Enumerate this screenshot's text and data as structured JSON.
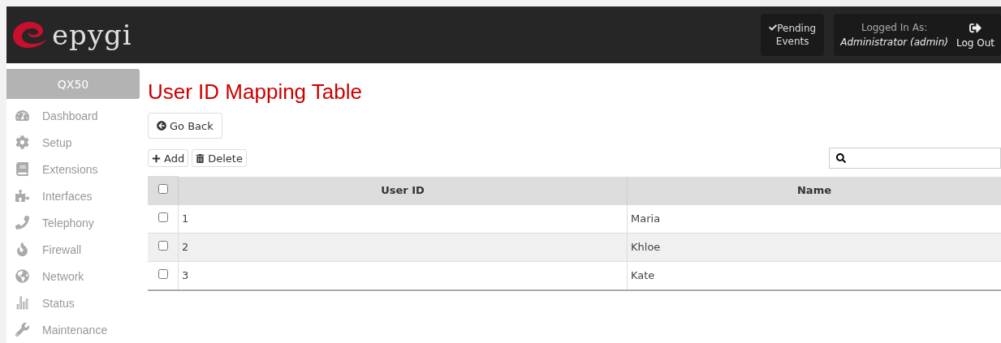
{
  "header": {
    "logo": "epygi",
    "pending_events": {
      "label": "Pending Events"
    },
    "user": {
      "caption": "Logged In As:",
      "name": "Administrator (admin)"
    },
    "logout": "Log Out"
  },
  "sidebar": {
    "device": "QX50",
    "items": [
      {
        "kind": "dashboard",
        "label": "Dashboard"
      },
      {
        "kind": "setup",
        "label": "Setup"
      },
      {
        "kind": "extensions",
        "label": "Extensions"
      },
      {
        "kind": "interfaces",
        "label": "Interfaces"
      },
      {
        "kind": "telephony",
        "label": "Telephony"
      },
      {
        "kind": "firewall",
        "label": "Firewall"
      },
      {
        "kind": "network",
        "label": "Network"
      },
      {
        "kind": "status",
        "label": "Status"
      },
      {
        "kind": "maintenance",
        "label": "Maintenance"
      }
    ]
  },
  "page": {
    "title": "User ID Mapping Table",
    "back_button": "Go Back",
    "toolbar": [
      "Add",
      "Delete"
    ]
  },
  "table": {
    "select_all": {
      "checked": false
    },
    "columns": [
      "User ID",
      "Name"
    ],
    "rows": [
      {
        "checked": false,
        "cells": [
          "1",
          "Maria"
        ]
      },
      {
        "checked": false,
        "cells": [
          "2",
          "Khloe"
        ]
      },
      {
        "checked": false,
        "cells": [
          "3",
          "Kate"
        ]
      }
    ]
  }
}
